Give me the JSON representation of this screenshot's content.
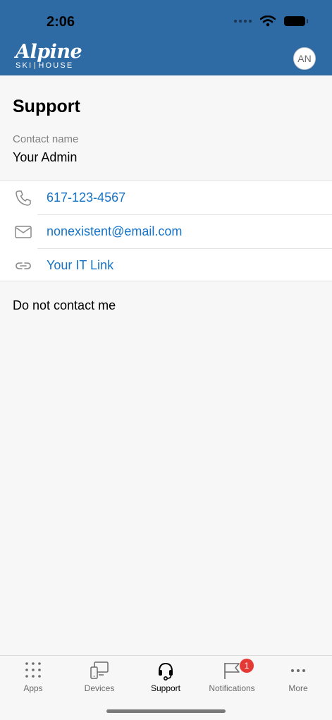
{
  "status_bar": {
    "time": "2:06"
  },
  "header": {
    "logo_main": "Alpine",
    "logo_sub_left": "SKI",
    "logo_sub_right": "HOUSE",
    "avatar_initials": "AN"
  },
  "page": {
    "title": "Support",
    "contact_label": "Contact name",
    "contact_name": "Your Admin",
    "contact_rows": [
      {
        "icon": "phone-icon",
        "text": "617-123-4567"
      },
      {
        "icon": "mail-icon",
        "text": "nonexistent@email.com"
      },
      {
        "icon": "link-icon",
        "text": "Your IT Link"
      }
    ],
    "no_contact_text": "Do not contact me"
  },
  "tabbar": {
    "tabs": [
      {
        "label": "Apps",
        "icon": "apps-grid-icon"
      },
      {
        "label": "Devices",
        "icon": "devices-icon"
      },
      {
        "label": "Support",
        "icon": "headset-icon",
        "active": true
      },
      {
        "label": "Notifications",
        "icon": "flag-icon",
        "badge": "1"
      },
      {
        "label": "More",
        "icon": "more-dots-icon"
      }
    ]
  },
  "colors": {
    "header_bg": "#2e6aa3",
    "link": "#1674c8",
    "badge": "#e53935"
  }
}
